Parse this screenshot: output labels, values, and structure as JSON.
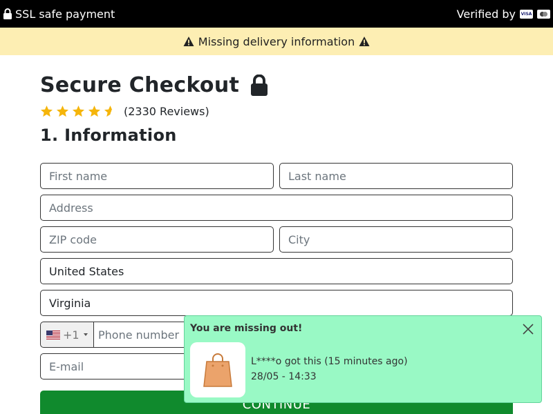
{
  "topbar": {
    "left_text": "SSL safe payment",
    "right_text": "Verified by",
    "card_badges": [
      "VISA",
      "mastercard"
    ]
  },
  "alert": {
    "text": "Missing delivery information"
  },
  "page": {
    "title": "Secure Checkout",
    "reviews": "(2330 Reviews)",
    "rating": 4.5,
    "section_title": "1. Information"
  },
  "form": {
    "first_name": {
      "placeholder": "First name",
      "value": ""
    },
    "last_name": {
      "placeholder": "Last name",
      "value": ""
    },
    "address": {
      "placeholder": "Address",
      "value": ""
    },
    "zip": {
      "placeholder": "ZIP code",
      "value": ""
    },
    "city": {
      "placeholder": "City",
      "value": ""
    },
    "country": {
      "value": "United States"
    },
    "state": {
      "value": "Virginia"
    },
    "phone": {
      "prefix": "+1",
      "placeholder": "Phone number",
      "value": ""
    },
    "email": {
      "placeholder": "E-mail",
      "value": ""
    },
    "continue_label": "CONTINUE"
  },
  "toast": {
    "title": "You are missing out!",
    "line1": "L****o got this (15 minutes ago)",
    "line2": "28/05 - 14:33"
  },
  "colors": {
    "topbar_bg": "#000000",
    "alert_bg": "#fdeeb3",
    "star": "#f5b50a",
    "continue_bg": "#108a2d",
    "toast_bg": "#99f9c5"
  }
}
